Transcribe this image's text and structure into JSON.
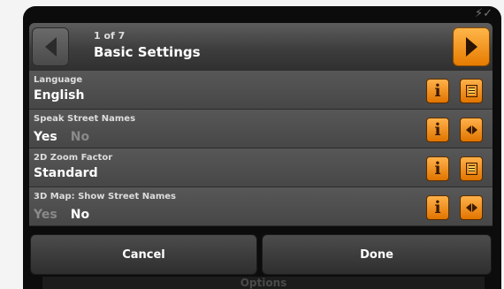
{
  "header": {
    "page_count": "1 of 7",
    "title": "Basic Settings"
  },
  "settings": [
    {
      "label": "Language",
      "value": "English",
      "control": "list"
    },
    {
      "label": "Speak Street Names",
      "options": [
        {
          "text": "Yes",
          "selected": true
        },
        {
          "text": "No",
          "selected": false
        }
      ],
      "control": "toggle"
    },
    {
      "label": "2D Zoom Factor",
      "value": "Standard",
      "control": "list"
    },
    {
      "label": "3D Map: Show Street Names",
      "options": [
        {
          "text": "Yes",
          "selected": false
        },
        {
          "text": "No",
          "selected": true
        }
      ],
      "control": "toggle"
    }
  ],
  "footer": {
    "cancel_label": "Cancel",
    "done_label": "Done",
    "background_label": "Options"
  },
  "icons": {
    "prev": "arrow-left-icon",
    "next": "arrow-right-icon",
    "info": "info-icon",
    "list": "list-icon",
    "toggle": "left-right-arrows-icon"
  },
  "colors": {
    "accent": "#f39a1e",
    "panel": "#4f4f4f",
    "text": "#ffffff",
    "inactive_text": "#8a8a8a"
  }
}
